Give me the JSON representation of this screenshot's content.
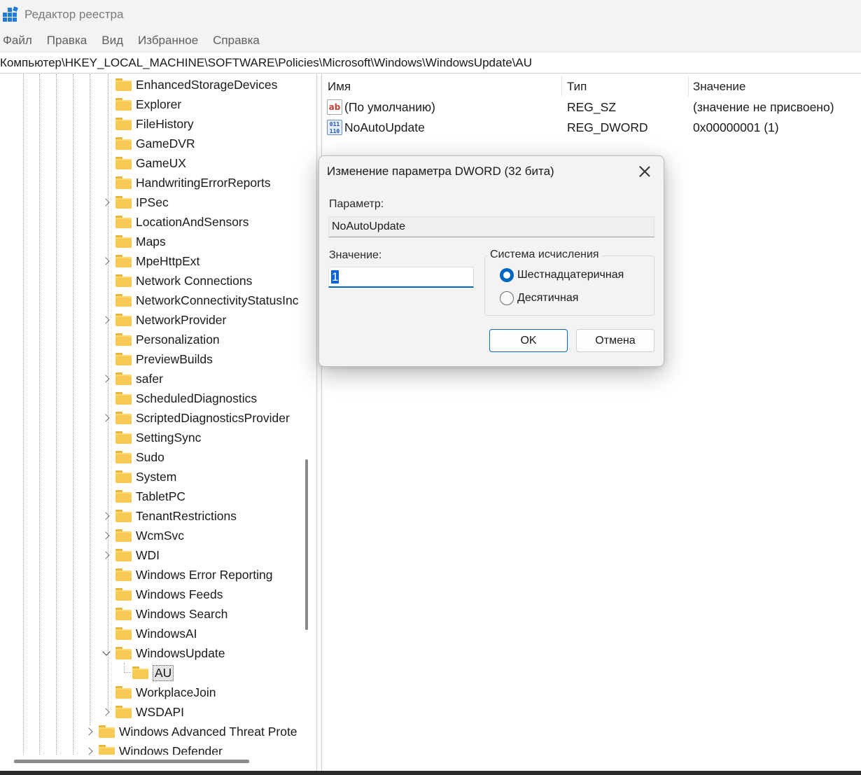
{
  "window": {
    "title": "Редактор реестра"
  },
  "menu": [
    "Файл",
    "Правка",
    "Вид",
    "Избранное",
    "Справка"
  ],
  "address": "Компьютер\\HKEY_LOCAL_MACHINE\\SOFTWARE\\Policies\\Microsoft\\Windows\\WindowsUpdate\\AU",
  "tree": [
    {
      "label": "EnhancedStorageDevices",
      "chevron": "none",
      "level": 0
    },
    {
      "label": "Explorer",
      "chevron": "none",
      "level": 0
    },
    {
      "label": "FileHistory",
      "chevron": "none",
      "level": 0
    },
    {
      "label": "GameDVR",
      "chevron": "none",
      "level": 0
    },
    {
      "label": "GameUX",
      "chevron": "none",
      "level": 0
    },
    {
      "label": "HandwritingErrorReports",
      "chevron": "none",
      "level": 0
    },
    {
      "label": "IPSec",
      "chevron": "right",
      "level": 0
    },
    {
      "label": "LocationAndSensors",
      "chevron": "none",
      "level": 0
    },
    {
      "label": "Maps",
      "chevron": "none",
      "level": 0
    },
    {
      "label": "MpeHttpExt",
      "chevron": "right",
      "level": 0
    },
    {
      "label": "Network Connections",
      "chevron": "none",
      "level": 0
    },
    {
      "label": "NetworkConnectivityStatusInc",
      "chevron": "none",
      "level": 0
    },
    {
      "label": "NetworkProvider",
      "chevron": "right",
      "level": 0
    },
    {
      "label": "Personalization",
      "chevron": "none",
      "level": 0
    },
    {
      "label": "PreviewBuilds",
      "chevron": "none",
      "level": 0
    },
    {
      "label": "safer",
      "chevron": "right",
      "level": 0
    },
    {
      "label": "ScheduledDiagnostics",
      "chevron": "none",
      "level": 0
    },
    {
      "label": "ScriptedDiagnosticsProvider",
      "chevron": "right",
      "level": 0
    },
    {
      "label": "SettingSync",
      "chevron": "none",
      "level": 0
    },
    {
      "label": "Sudo",
      "chevron": "none",
      "level": 0
    },
    {
      "label": "System",
      "chevron": "none",
      "level": 0
    },
    {
      "label": "TabletPC",
      "chevron": "none",
      "level": 0
    },
    {
      "label": "TenantRestrictions",
      "chevron": "right",
      "level": 0
    },
    {
      "label": "WcmSvc",
      "chevron": "right",
      "level": 0
    },
    {
      "label": "WDI",
      "chevron": "right",
      "level": 0
    },
    {
      "label": "Windows Error Reporting",
      "chevron": "none",
      "level": 0
    },
    {
      "label": "Windows Feeds",
      "chevron": "none",
      "level": 0
    },
    {
      "label": "Windows Search",
      "chevron": "none",
      "level": 0
    },
    {
      "label": "WindowsAI",
      "chevron": "none",
      "level": 0
    },
    {
      "label": "WindowsUpdate",
      "chevron": "down",
      "level": 0
    },
    {
      "label": "AU",
      "chevron": "none",
      "level": 1,
      "selected": true
    },
    {
      "label": "WorkplaceJoin",
      "chevron": "none",
      "level": 0
    },
    {
      "label": "WSDAPI",
      "chevron": "right",
      "level": 0
    },
    {
      "label": "Windows Advanced Threat Prote",
      "chevron": "right",
      "level": -1
    },
    {
      "label": "Windows Defender",
      "chevron": "right",
      "level": -1
    }
  ],
  "list": {
    "columns": [
      "Имя",
      "Тип",
      "Значение"
    ],
    "rows": [
      {
        "icon": "string-value-icon",
        "name": "(По умолчанию)",
        "type": "REG_SZ",
        "value": "(значение не присвоено)"
      },
      {
        "icon": "dword-value-icon",
        "name": "NoAutoUpdate",
        "type": "REG_DWORD",
        "value": "0x00000001 (1)"
      }
    ]
  },
  "dialog": {
    "title": "Изменение параметра DWORD (32 бита)",
    "param_label": "Параметр:",
    "param_value": "NoAutoUpdate",
    "value_label": "Значение:",
    "value": "1",
    "base_label": "Система исчисления",
    "radio_hex": "Шестнадцатеричная",
    "radio_dec": "Десятичная",
    "selected_base": "hex",
    "ok": "OK",
    "cancel": "Отмена"
  },
  "colors": {
    "accent": "#0067c0",
    "folder": "#f7cb53",
    "selection": "#0a64d8"
  }
}
